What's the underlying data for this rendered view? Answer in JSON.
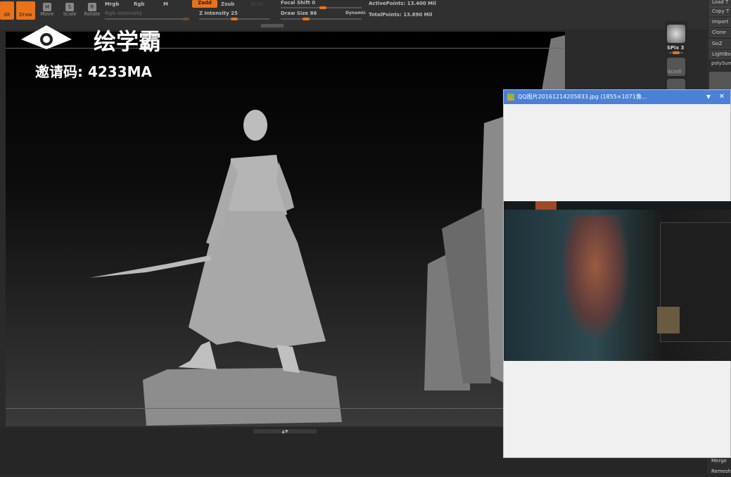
{
  "toolbar": {
    "edit": "dit",
    "draw": "Draw",
    "move": "Move",
    "scale": "Scale",
    "rotate": "Rotate",
    "move_key": "M",
    "scale_key": "S",
    "rotate_key": "R",
    "mrgb": "Mrgb",
    "rgb": "Rgb",
    "m": "M",
    "rgb_intensity": "Rgb Intensity",
    "zadd": "Zadd",
    "zsub": "Zsub",
    "zcut": "Zcut",
    "z_intensity": "Z Intensity 25",
    "focal_shift": "Focal Shift 0",
    "draw_size": "Draw Size 86",
    "dynamic": "Dynamic",
    "active_points": "ActivePoints: 13.400 Mil",
    "total_points": "TotalPoints: 13.890 Mil",
    "z_intensity_value": 25,
    "draw_size_value": 86,
    "focal_shift_value": 0
  },
  "overlay": {
    "logo_text": "绘学霸",
    "invite": "邀请码: 4233MA"
  },
  "shelf": {
    "spix": "SPix 3",
    "scroll": "Scroll"
  },
  "right_panel": {
    "items": [
      "Load T",
      "Copy T",
      "Import",
      "Clone",
      "GoZ",
      "LightBox",
      "polySum"
    ],
    "bottom_items": [
      "Merge",
      "Remesh"
    ]
  },
  "viewer": {
    "title": "QQ图片20161214205833.jpg (1855×1071像...",
    "accent": "#4a80d6"
  },
  "colors": {
    "accent": "#e8731a"
  }
}
